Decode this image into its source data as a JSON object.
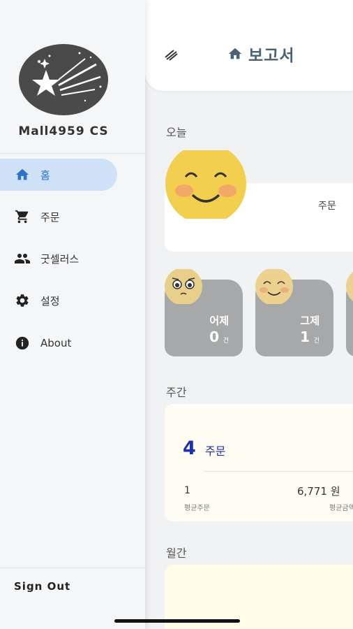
{
  "header": {
    "title": "보고서",
    "menu_icon": "menu-lines-icon",
    "title_icon": "home-icon"
  },
  "sections": {
    "today": "오늘",
    "weekly": "주간",
    "monthly": "월간"
  },
  "today_card": {
    "label": "주문"
  },
  "mini_cards": [
    {
      "title": "어제",
      "value": "0",
      "unit": "건",
      "emoji": "pleading-face-icon"
    },
    {
      "title": "그제",
      "value": "1",
      "unit": "건",
      "emoji": "smiling-face-icon"
    }
  ],
  "weekly": {
    "orders": "4",
    "orders_unit": "주문",
    "avg_orders": "1",
    "avg_orders_label": "평균주문",
    "avg_amount": "6,771 원",
    "avg_amount_label": "평균금액"
  },
  "drawer": {
    "store_name": "Mall4959 CS",
    "items": [
      {
        "label": "홈",
        "icon": "home-icon",
        "active": true
      },
      {
        "label": "주문",
        "icon": "cart-icon",
        "active": false
      },
      {
        "label": "굿셀러스",
        "icon": "people-icon",
        "active": false
      },
      {
        "label": "설정",
        "icon": "gear-icon",
        "active": false
      },
      {
        "label": "About",
        "icon": "info-icon",
        "active": false
      }
    ],
    "sign_out": "Sign Out"
  },
  "colors": {
    "accent": "#2a73c9",
    "active_bg": "#cfe2f7",
    "value_blue": "#1b2fb3",
    "title": "#4a6275"
  }
}
